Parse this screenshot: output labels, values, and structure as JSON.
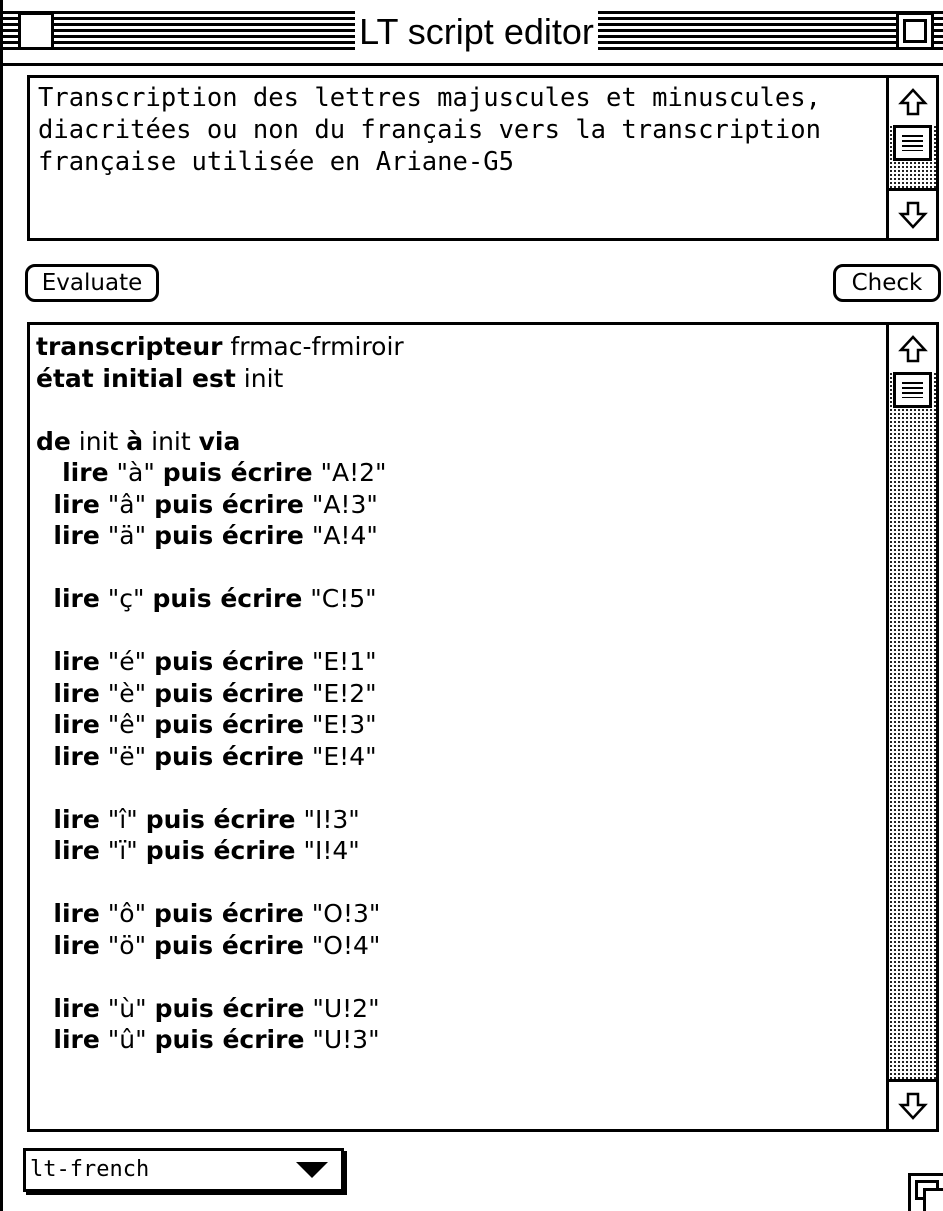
{
  "window": {
    "title": "LT script editor"
  },
  "description": {
    "text": "Transcription des lettres majuscules et minuscules, diacritées ou non du français vers la transcription française utilisée en Ariane-G5"
  },
  "buttons": {
    "evaluate_label": "Evaluate",
    "check_label": "Check"
  },
  "code_lines": [
    [
      {
        "t": "transcripteur",
        "b": true
      },
      {
        "t": " frmac-frmiroir",
        "b": false
      }
    ],
    [
      {
        "t": "état initial est",
        "b": true
      },
      {
        "t": " init",
        "b": false
      }
    ],
    [],
    [
      {
        "t": "de",
        "b": true
      },
      {
        "t": " init ",
        "b": false
      },
      {
        "t": "à",
        "b": true
      },
      {
        "t": " init ",
        "b": false
      },
      {
        "t": "via",
        "b": true
      }
    ],
    [
      {
        "t": "   lire",
        "b": true
      },
      {
        "t": " \"à\" ",
        "b": false
      },
      {
        "t": "puis écrire",
        "b": true
      },
      {
        "t": " \"A!2\"",
        "b": false
      }
    ],
    [
      {
        "t": "  lire",
        "b": true
      },
      {
        "t": " \"â\" ",
        "b": false
      },
      {
        "t": "puis écrire",
        "b": true
      },
      {
        "t": " \"A!3\"",
        "b": false
      }
    ],
    [
      {
        "t": "  lire",
        "b": true
      },
      {
        "t": " \"ä\" ",
        "b": false
      },
      {
        "t": "puis écrire",
        "b": true
      },
      {
        "t": " \"A!4\"",
        "b": false
      }
    ],
    [],
    [
      {
        "t": "  lire",
        "b": true
      },
      {
        "t": " \"ç\" ",
        "b": false
      },
      {
        "t": "puis écrire",
        "b": true
      },
      {
        "t": " \"C!5\"",
        "b": false
      }
    ],
    [],
    [
      {
        "t": "  lire",
        "b": true
      },
      {
        "t": " \"é\" ",
        "b": false
      },
      {
        "t": "puis écrire",
        "b": true
      },
      {
        "t": " \"E!1\"",
        "b": false
      }
    ],
    [
      {
        "t": "  lire",
        "b": true
      },
      {
        "t": " \"è\" ",
        "b": false
      },
      {
        "t": "puis écrire",
        "b": true
      },
      {
        "t": " \"E!2\"",
        "b": false
      }
    ],
    [
      {
        "t": "  lire",
        "b": true
      },
      {
        "t": " \"ê\" ",
        "b": false
      },
      {
        "t": "puis écrire",
        "b": true
      },
      {
        "t": " \"E!3\"",
        "b": false
      }
    ],
    [
      {
        "t": "  lire",
        "b": true
      },
      {
        "t": " \"ë\" ",
        "b": false
      },
      {
        "t": "puis écrire",
        "b": true
      },
      {
        "t": " \"E!4\"",
        "b": false
      }
    ],
    [],
    [
      {
        "t": "  lire",
        "b": true
      },
      {
        "t": " \"î\" ",
        "b": false
      },
      {
        "t": "puis écrire",
        "b": true
      },
      {
        "t": " \"I!3\"",
        "b": false
      }
    ],
    [
      {
        "t": "  lire",
        "b": true
      },
      {
        "t": " \"ï\" ",
        "b": false
      },
      {
        "t": "puis écrire",
        "b": true
      },
      {
        "t": " \"I!4\"",
        "b": false
      }
    ],
    [],
    [
      {
        "t": "  lire",
        "b": true
      },
      {
        "t": " \"ô\" ",
        "b": false
      },
      {
        "t": "puis écrire",
        "b": true
      },
      {
        "t": " \"O!3\"",
        "b": false
      }
    ],
    [
      {
        "t": "  lire",
        "b": true
      },
      {
        "t": " \"ö\" ",
        "b": false
      },
      {
        "t": "puis écrire",
        "b": true
      },
      {
        "t": " \"O!4\"",
        "b": false
      }
    ],
    [],
    [
      {
        "t": "  lire",
        "b": true
      },
      {
        "t": " \"ù\" ",
        "b": false
      },
      {
        "t": "puis écrire",
        "b": true
      },
      {
        "t": " \"U!2\"",
        "b": false
      }
    ],
    [
      {
        "t": "  lire",
        "b": true
      },
      {
        "t": " \"û\" ",
        "b": false
      },
      {
        "t": "puis écrire",
        "b": true
      },
      {
        "t": " \"U!3\"",
        "b": false
      }
    ]
  ],
  "language_popup": {
    "selected": "lt-french"
  },
  "icons": {
    "close": "close-box-icon",
    "zoom": "zoom-box-icon",
    "scroll_up": "up-arrow-icon",
    "scroll_down": "down-arrow-icon",
    "popup": "triangle-down-icon",
    "grow": "size-box-icon"
  }
}
